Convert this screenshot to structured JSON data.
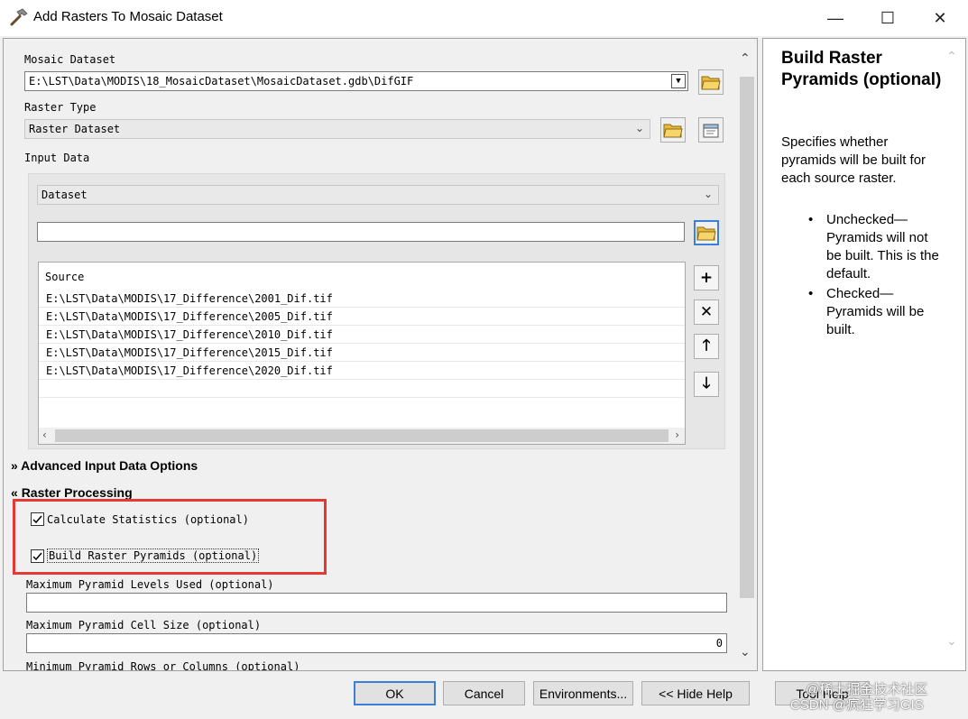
{
  "window": {
    "title": "Add Rasters To Mosaic Dataset",
    "minimize_glyph": "—",
    "maximize_glyph": "☐",
    "close_glyph": "✕"
  },
  "form": {
    "mosaic_dataset_label": "Mosaic Dataset",
    "mosaic_dataset_value": "E:\\LST\\Data\\MODIS\\18_MosaicDataset\\MosaicDataset.gdb\\DifGIF",
    "raster_type_label": "Raster Type",
    "raster_type_value": "Raster Dataset",
    "input_data_label": "Input Data",
    "input_data_type": "Dataset",
    "input_path_value": "",
    "source_header": "Source",
    "sources": [
      "E:\\LST\\Data\\MODIS\\17_Difference\\2001_Dif.tif",
      "E:\\LST\\Data\\MODIS\\17_Difference\\2005_Dif.tif",
      "E:\\LST\\Data\\MODIS\\17_Difference\\2010_Dif.tif",
      "E:\\LST\\Data\\MODIS\\17_Difference\\2015_Dif.tif",
      "E:\\LST\\Data\\MODIS\\17_Difference\\2020_Dif.tif"
    ],
    "advanced_section": "Advanced Input Data Options",
    "raster_processing_section": "Raster Processing",
    "calculate_statistics_label": "Calculate Statistics (optional)",
    "calculate_statistics_checked": true,
    "build_pyramids_label": "Build Raster Pyramids (optional)",
    "build_pyramids_checked": true,
    "max_pyramid_levels_label": "Maximum Pyramid Levels Used (optional)",
    "max_pyramid_levels_value": "",
    "max_pyramid_cell_label": "Maximum Pyramid Cell Size (optional)",
    "max_pyramid_cell_value": "0",
    "min_pyramid_rows_label": "Minimum Pyramid Rows or Columns (optional)"
  },
  "help": {
    "title": "Build Raster Pyramids (optional)",
    "description": "Specifies whether pyramids will be built for each source raster.",
    "bullets": [
      "Unchecked—Pyramids will not be built. This is the default.",
      "Checked—Pyramids will be built."
    ]
  },
  "buttons": {
    "ok": "OK",
    "cancel": "Cancel",
    "environments": "Environments...",
    "hide_help": "<< Hide Help",
    "tool_help": "Tool Help"
  },
  "watermark": {
    "line1": "@稀土掘金技术社区",
    "line2": "CSDN @疯狂学习GIS"
  },
  "icons": {
    "add": "plus-icon",
    "remove": "x-icon",
    "up": "arrow-up-icon",
    "down": "arrow-down-icon"
  },
  "colors": {
    "highlight_box": "#e53935",
    "focus": "#3c7fd8"
  }
}
